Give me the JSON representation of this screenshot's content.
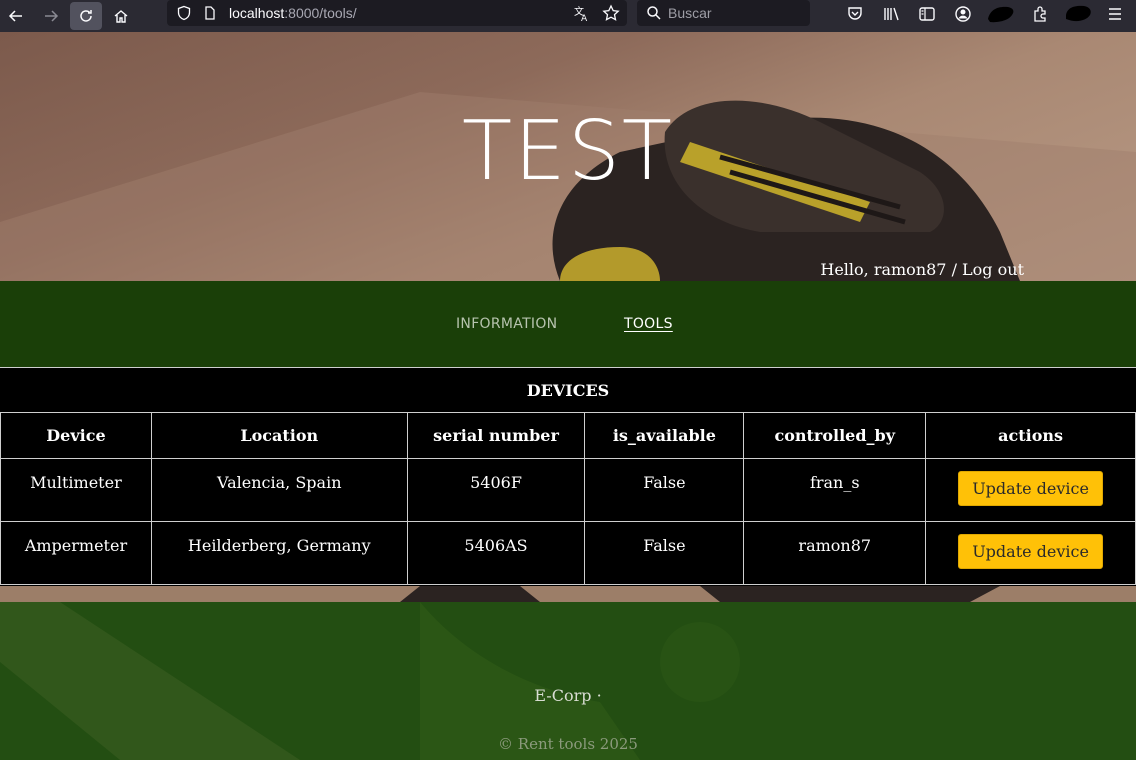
{
  "browser": {
    "url_host": "localhost",
    "url_rest": ":8000/tools/",
    "search_placeholder": "Buscar"
  },
  "hero": {
    "title": "TEST",
    "greeting": "Hello, ramon87 / Log out"
  },
  "nav": {
    "items": [
      {
        "label": "INFORMATION"
      },
      {
        "label": "TOOLS"
      }
    ]
  },
  "table": {
    "caption": "DEVICES",
    "headers": [
      "Device",
      "Location",
      "serial number",
      "is_available",
      "controlled_by",
      "actions"
    ],
    "rows": [
      {
        "device": "Multimeter",
        "location": "Valencia, Spain",
        "serial": "5406F",
        "available": "False",
        "controlled_by": "fran_s",
        "action": "Update device"
      },
      {
        "device": "Ampermeter",
        "location": "Heilderberg, Germany",
        "serial": "5406AS",
        "available": "False",
        "controlled_by": "ramon87",
        "action": "Update device"
      }
    ]
  },
  "footer": {
    "brand": "E-Corp ·",
    "copyright": "© Rent tools 2025"
  },
  "colors": {
    "nav_bg": "#1a3f08",
    "footer_bg": "#234e12",
    "button": "#ffc107"
  }
}
